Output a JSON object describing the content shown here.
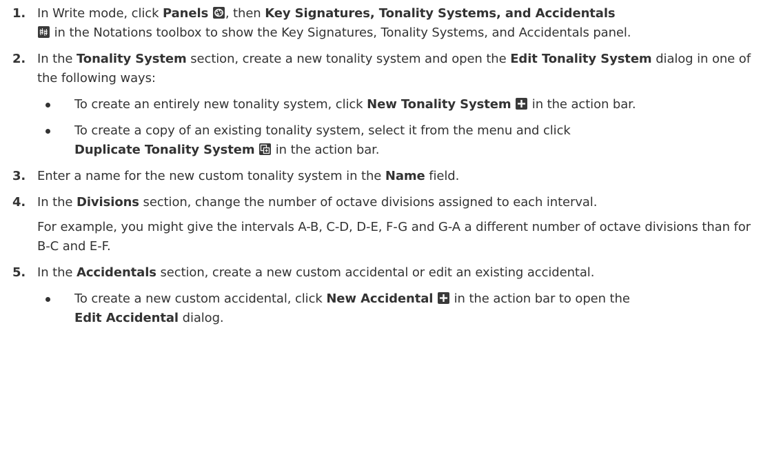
{
  "steps": [
    {
      "number": "1.",
      "t1": "In Write mode, click ",
      "b1": "Panels",
      "t2": ", then ",
      "b2": "Key Signatures, Tonality Systems, and Accidentals",
      "t3": " in the Notations toolbox to show the Key Signatures, Tonality Systems, and Accidentals panel."
    },
    {
      "number": "2.",
      "t1": "In the ",
      "b1": "Tonality System",
      "t2": " section, create a new tonality system and open the ",
      "b2": "Edit Tonality System",
      "t3": " dialog in one of the following ways:",
      "bullets": [
        {
          "t1": "To create an entirely new tonality system, click ",
          "b1": "New Tonality System",
          "t2": " in the action bar."
        },
        {
          "t1": "To create a copy of an existing tonality system, select it from the menu and click ",
          "b1": "Duplicate Tonality System",
          "t2": " in the action bar."
        }
      ]
    },
    {
      "number": "3.",
      "t1": "Enter a name for the new custom tonality system in the ",
      "b1": "Name",
      "t2": " field."
    },
    {
      "number": "4.",
      "t1": "In the ",
      "b1": "Divisions",
      "t2": " section, change the number of octave divisions assigned to each interval.",
      "extra": "For example, you might give the intervals A-B, C-D, D-E, F-G and G-A a different number of octave divisions than for B-C and E-F."
    },
    {
      "number": "5.",
      "t1": "In the ",
      "b1": "Accidentals",
      "t2": " section, create a new custom accidental or edit an existing accidental.",
      "bullets": [
        {
          "t1": "To create a new custom accidental, click ",
          "b1": "New Accidental",
          "t2": " in the action bar to open the ",
          "b2": "Edit Accidental",
          "t3": " dialog."
        }
      ]
    }
  ],
  "icons": {
    "panels": "panels-icon",
    "key_signatures": "key-signatures-icon",
    "new": "plus-icon",
    "duplicate": "duplicate-icon",
    "icon_dark": "#3a3a3a",
    "icon_light": "#ffffff"
  }
}
